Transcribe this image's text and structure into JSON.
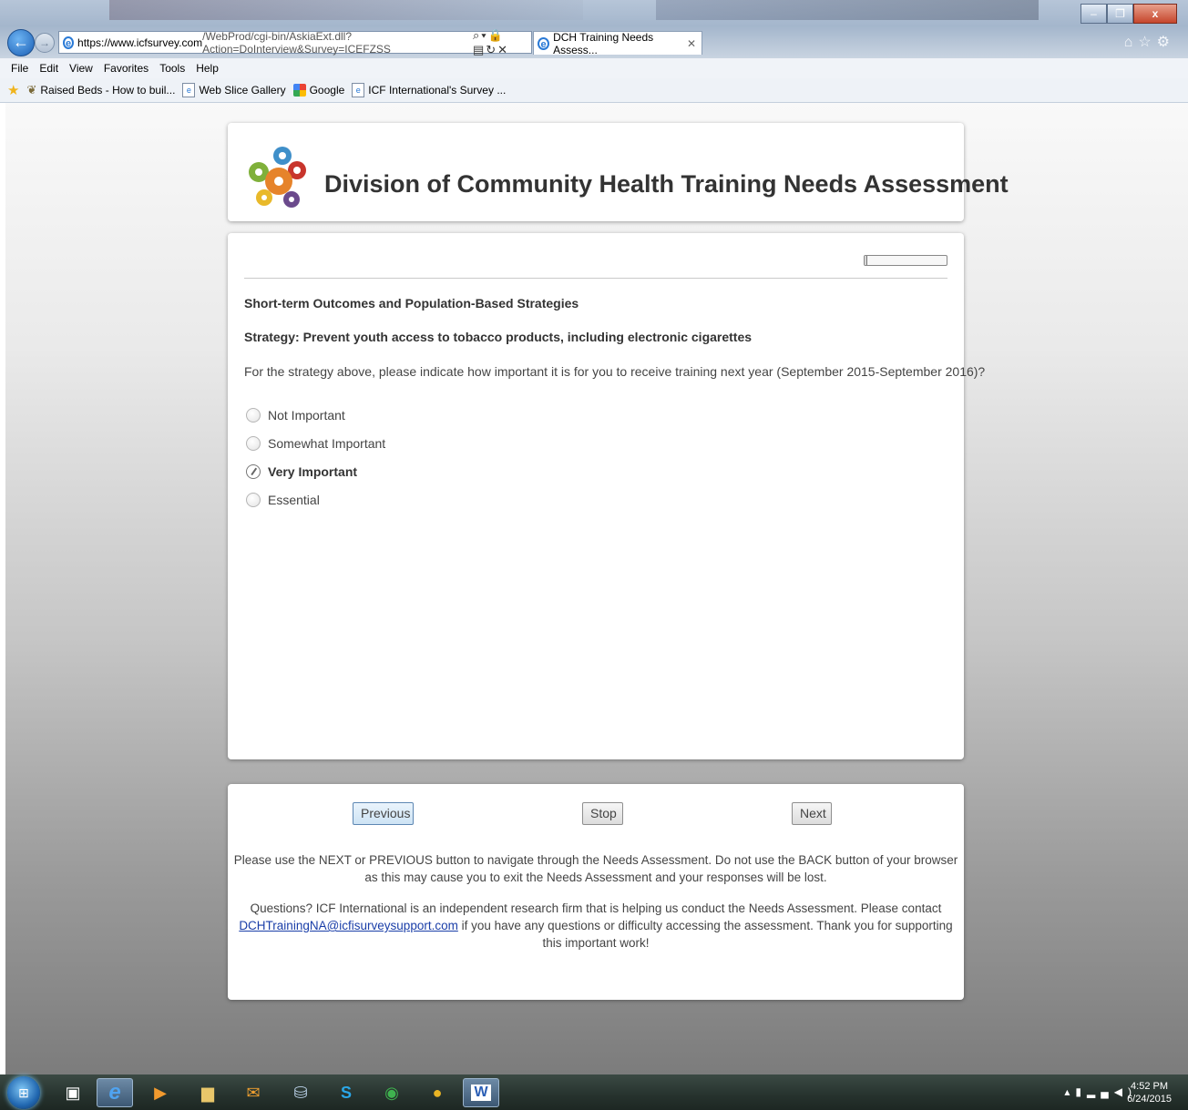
{
  "browser": {
    "url_host": "https://www.icfsurvey.com",
    "url_path": "/WebProd/cgi-bin/AskiaExt.dll?Action=DoInterview&Survey=ICEFZSS",
    "tab_title": "DCH Training Needs Assess...",
    "menu": [
      "File",
      "Edit",
      "View",
      "Favorites",
      "Tools",
      "Help"
    ],
    "favorites": [
      "Raised Beds - How to buil...",
      "Web Slice Gallery",
      "Google",
      "ICF International's Survey ..."
    ]
  },
  "header": {
    "title": "Division of Community Health Training Needs Assessment"
  },
  "question": {
    "progress_fraction": 0.02,
    "section_title": "Short-term Outcomes and Population-Based Strategies",
    "strategy": "Strategy: Prevent youth access to tobacco products, including electronic cigarettes",
    "prompt": "For the strategy above, please indicate how important it is for you to receive training next year (September 2015-September 2016)?",
    "options": [
      {
        "label": "Not Important",
        "selected": false
      },
      {
        "label": "Somewhat Important",
        "selected": false
      },
      {
        "label": "Very Important",
        "selected": true
      },
      {
        "label": "Essential",
        "selected": false
      }
    ]
  },
  "navigation": {
    "previous_label": "Previous",
    "stop_label": "Stop",
    "next_label": "Next",
    "notice": "Please use the NEXT or PREVIOUS button to navigate through the Needs Assessment. Do not use the BACK button of your browser as this may cause you to exit the Needs Assessment and your responses will be lost.",
    "contact_before": "Questions? ICF International is an independent research firm that is helping us conduct the Needs Assessment. Please contact",
    "contact_email": "DCHTrainingNA@icfisurveysupport.com",
    "contact_after": "if you have any questions or difficulty accessing the assessment. Thank you for supporting this important work!"
  },
  "taskbar": {
    "time": "4:52 PM",
    "date": "6/24/2015"
  }
}
